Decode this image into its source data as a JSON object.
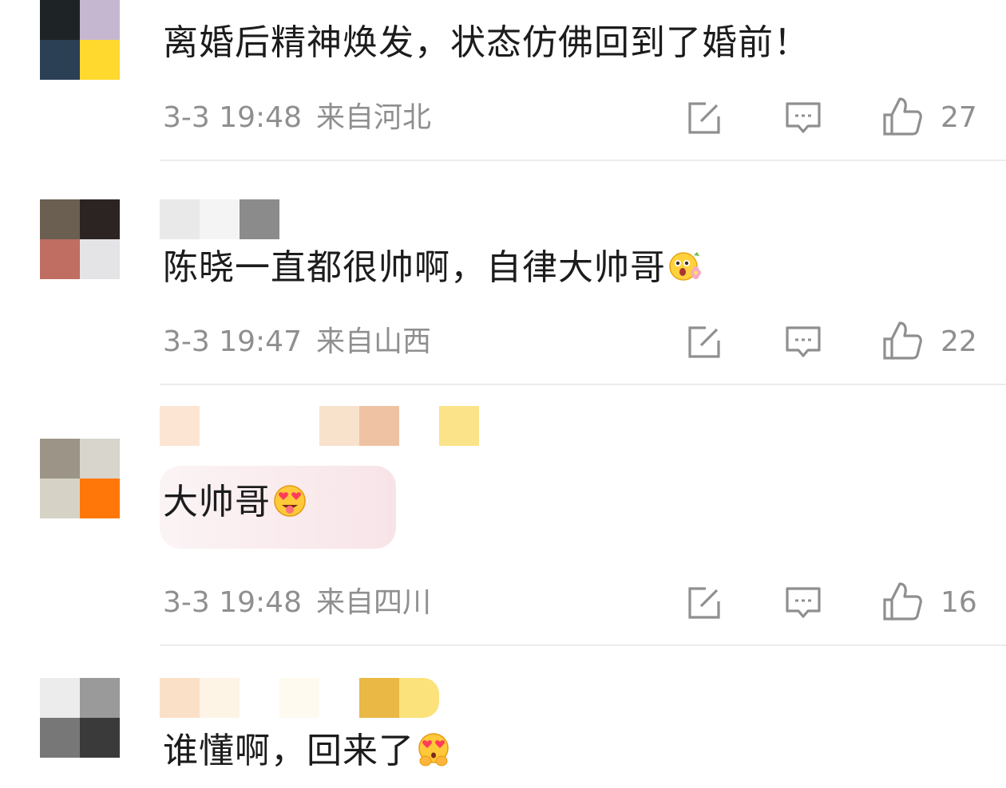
{
  "comments": [
    {
      "text": "离婚后精神焕发，状态仿佛回到了婚前！",
      "time": "3-3 19:48",
      "location": "来自河北",
      "likes": "27",
      "avatar_colors": [
        "#1e2426",
        "#c6b7d1",
        "#2b3f55",
        "#ffd92e"
      ],
      "name_colors": [
        "#f3e5d4",
        "#f3e5d4",
        "#f3e5d4",
        "#f3e5d4"
      ]
    },
    {
      "text": "陈晓一直都很帅啊，自律大帅哥",
      "emoji": "flower-face-emoji",
      "time": "3-3 19:47",
      "location": "来自山西",
      "likes": "22",
      "avatar_colors": [
        "#6b5f52",
        "#2c2422",
        "#c06e62",
        "#e4e4e7"
      ],
      "name_colors": [
        "#e9e9e9",
        "#f4f4f4",
        "#8b8b8b"
      ]
    },
    {
      "text": "大帅哥",
      "emoji": "heart-eyes-tongue-emoji",
      "time": "3-3 19:48",
      "location": "来自四川",
      "likes": "16",
      "avatar_colors": [
        "#9d9488",
        "#d7d5cc",
        "#d6d3c6",
        "#ff7708"
      ],
      "name_colors": [
        "#fde5d3",
        "#f8e2cb",
        "#efc2a3",
        "#fbe38a"
      ]
    },
    {
      "text": "谁懂啊，回来了",
      "emoji": "heart-eyes-hands-emoji",
      "avatar_colors": [
        "#ececec",
        "#9a9a9a",
        "#777777",
        "#3a3a3a"
      ],
      "name_colors": [
        "#fbe0c8",
        "#fdf4e6",
        "#fefaef",
        "#e9b845",
        "#fbe27a"
      ]
    }
  ],
  "icons": {
    "share": "share-icon",
    "reply": "comment-icon",
    "like": "thumbs-up-icon"
  },
  "colors": {
    "meta": "#8f8f8f",
    "divider": "#ececec",
    "bubble": "#f8e4e8"
  }
}
